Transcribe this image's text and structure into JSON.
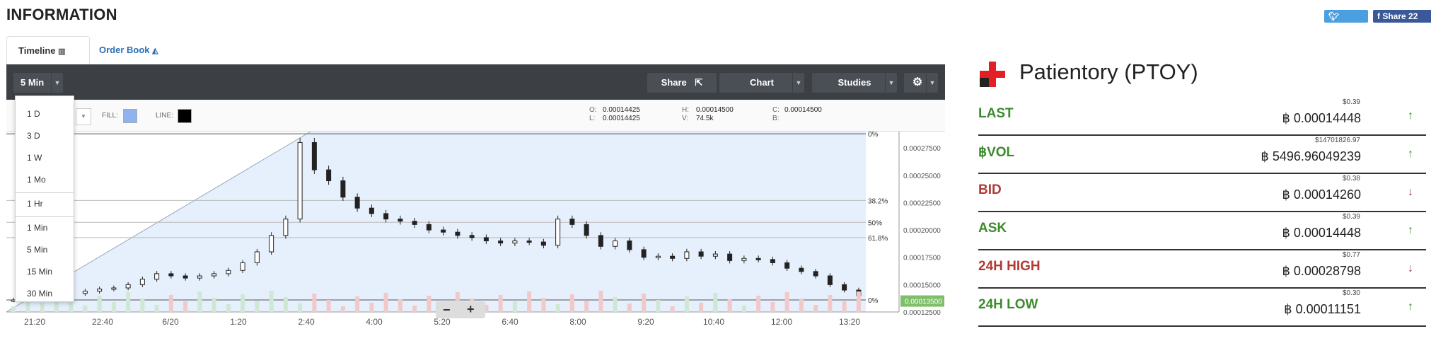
{
  "header": {
    "title": "INFORMATION",
    "tweet_label": "Tweet",
    "share_label": "Share 22"
  },
  "tabs": [
    {
      "label": "Timeline"
    },
    {
      "label": "Order Book"
    }
  ],
  "toolbar": {
    "interval": "5 Min",
    "share": "Share",
    "chart": "Chart",
    "studies": "Studies"
  },
  "interval_menu": [
    "1 D",
    "3 D",
    "1 W",
    "1 Mo",
    "1 Hr",
    "1 Min",
    "5 Min",
    "15 Min",
    "30 Min"
  ],
  "infobar": {
    "fill_label": "FILL:",
    "line_label": "LINE:",
    "o_label": "O:",
    "o": "0.00014425",
    "l_label": "L:",
    "l": "0.00014425",
    "h_label": "H:",
    "h": "0.00014500",
    "v_label": "V:",
    "v": "74.5k",
    "c_label": "C:",
    "c": "0.00014500",
    "b_label": "B:",
    "fill_color": "#8fb3ee",
    "line_color": "#000000"
  },
  "chart_data": {
    "type": "candlestick",
    "x_ticks": [
      "21:20",
      "22:40",
      "6/20",
      "1:20",
      "2:40",
      "4:00",
      "5:20",
      "6:40",
      "8:00",
      "9:20",
      "10:40",
      "12:00",
      "13:20"
    ],
    "y_ticks": [
      "0.00027500",
      "0.00025000",
      "0.00022500",
      "0.00020000",
      "0.00017500",
      "0.00015000",
      "0.00012500"
    ],
    "ylim": [
      0.000125,
      0.00029
    ],
    "fib_levels": [
      {
        "label": "0%",
        "value": 0.00028798
      },
      {
        "label": "38.2%",
        "value": 0.000227
      },
      {
        "label": "50%",
        "value": 0.000207
      },
      {
        "label": "61.8%",
        "value": 0.000193
      },
      {
        "label": "0%",
        "value": 0.000136
      }
    ],
    "current_price_label": "0.00013500",
    "close_series": [
      0.000136,
      0.000137,
      0.000138,
      0.00014,
      0.000142,
      0.000144,
      0.000146,
      0.000147,
      0.00015,
      0.000155,
      0.00016,
      0.000158,
      0.000156,
      0.000158,
      0.00016,
      0.000163,
      0.00017,
      0.00018,
      0.000195,
      0.00021,
      0.00028,
      0.000255,
      0.000245,
      0.00023,
      0.00022,
      0.000215,
      0.00021,
      0.000208,
      0.000205,
      0.0002,
      0.000198,
      0.000195,
      0.000193,
      0.00019,
      0.000188,
      0.00019,
      0.000189,
      0.000186,
      0.00021,
      0.000205,
      0.000195,
      0.000185,
      0.00019,
      0.000182,
      0.000175,
      0.000176,
      0.000174,
      0.00018,
      0.000176,
      0.000178,
      0.000172,
      0.000174,
      0.000173,
      0.00017,
      0.000165,
      0.000162,
      0.000158,
      0.00015,
      0.000145,
      0.00014
    ],
    "zoom_out": "−",
    "zoom_in": "+"
  },
  "coin": {
    "title": "Patientory (PTOY)"
  },
  "stats": [
    {
      "label": "LAST",
      "usd": "$0.39",
      "value": "฿ 0.00014448",
      "color": "green",
      "arrow": "↑"
    },
    {
      "label": "฿VOL",
      "usd": "$14701826.97",
      "value": "฿ 5496.96049239",
      "color": "green",
      "arrow": "↑"
    },
    {
      "label": "BID",
      "usd": "$0.38",
      "value": "฿ 0.00014260",
      "color": "red",
      "arrow": "↓"
    },
    {
      "label": "ASK",
      "usd": "$0.39",
      "value": "฿ 0.00014448",
      "color": "green",
      "arrow": "↑"
    },
    {
      "label": "24H HIGH",
      "usd": "$0.77",
      "value": "฿ 0.00028798",
      "color": "red",
      "arrow": "↓"
    },
    {
      "label": "24H LOW",
      "usd": "$0.30",
      "value": "฿ 0.00011151",
      "color": "green",
      "arrow": "↑"
    }
  ]
}
